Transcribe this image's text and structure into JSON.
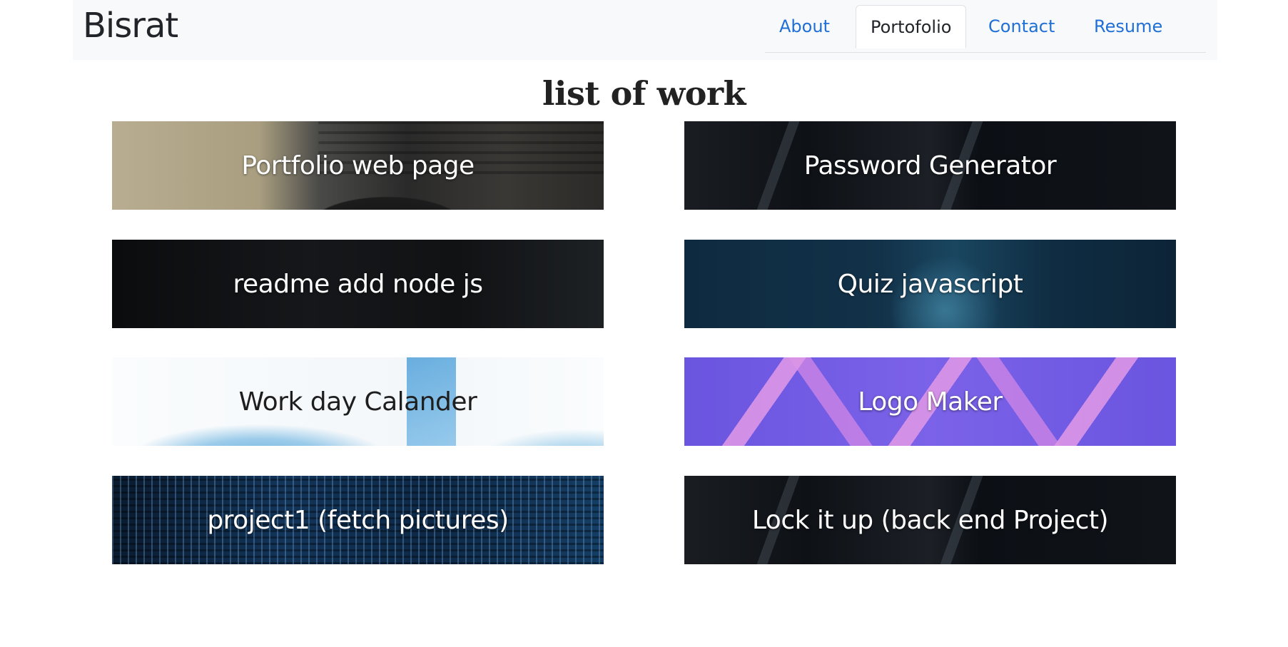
{
  "navbar": {
    "brand": "Bisrat",
    "tabs": [
      {
        "label": "About",
        "active": false
      },
      {
        "label": "Portofolio",
        "active": true
      },
      {
        "label": "Contact",
        "active": false
      },
      {
        "label": "Resume",
        "active": false
      }
    ]
  },
  "main": {
    "heading": "list of work",
    "projects": [
      {
        "title": "Portfolio web page"
      },
      {
        "title": "Password Generator"
      },
      {
        "title": "readme add node js"
      },
      {
        "title": "Quiz javascript"
      },
      {
        "title": "Work day Calander"
      },
      {
        "title": "Logo Maker"
      },
      {
        "title": "project1 (fetch pictures)"
      },
      {
        "title": "Lock it up (back end Project)"
      }
    ]
  },
  "colors": {
    "nav_bg": "#f8f9fa",
    "link": "#1f6fd6",
    "text": "#212529"
  }
}
